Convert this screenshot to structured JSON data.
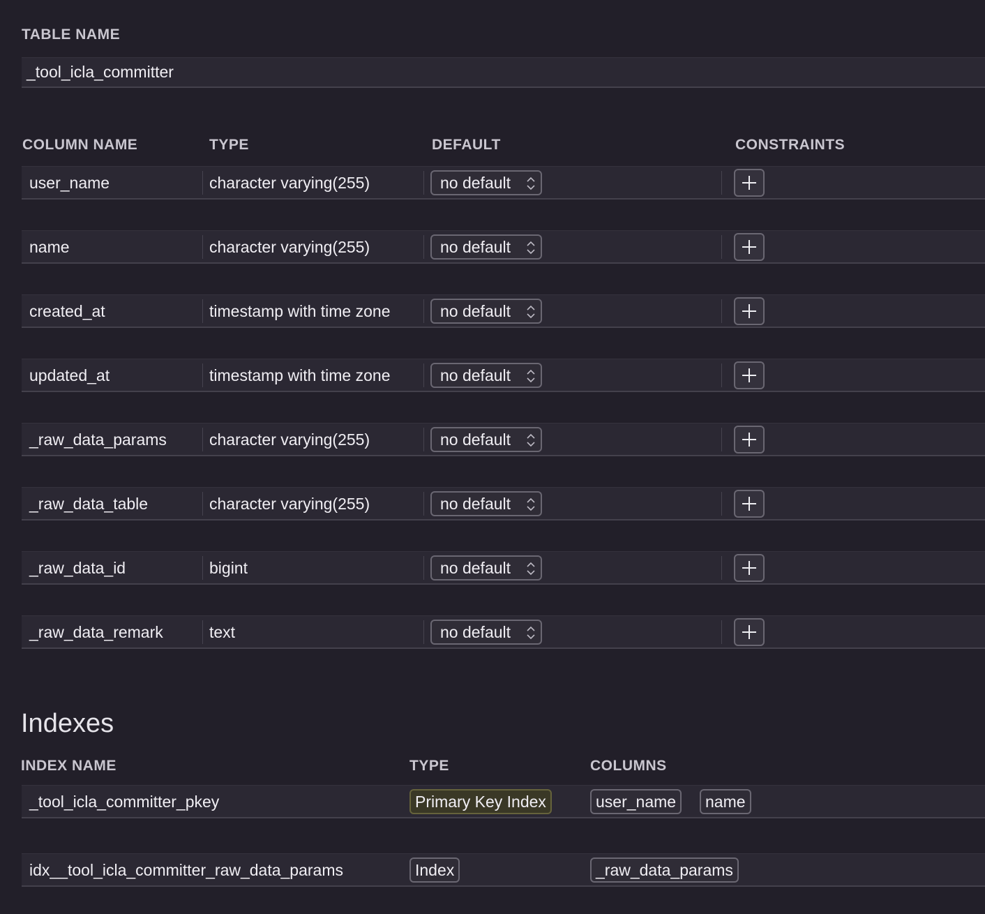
{
  "table": {
    "label": "TABLE NAME",
    "name": "_tool_icla_committer"
  },
  "columns_header": {
    "name": "COLUMN NAME",
    "type": "TYPE",
    "default": "DEFAULT",
    "constraints": "CONSTRAINTS"
  },
  "columns": [
    {
      "name": "user_name",
      "type": "character varying(255)",
      "default": "no default"
    },
    {
      "name": "name",
      "type": "character varying(255)",
      "default": "no default"
    },
    {
      "name": "created_at",
      "type": "timestamp with time zone",
      "default": "no default"
    },
    {
      "name": "updated_at",
      "type": "timestamp with time zone",
      "default": "no default"
    },
    {
      "name": "_raw_data_params",
      "type": "character varying(255)",
      "default": "no default"
    },
    {
      "name": "_raw_data_table",
      "type": "character varying(255)",
      "default": "no default"
    },
    {
      "name": "_raw_data_id",
      "type": "bigint",
      "default": "no default"
    },
    {
      "name": "_raw_data_remark",
      "type": "text",
      "default": "no default"
    }
  ],
  "indexes": {
    "title": "Indexes",
    "header": {
      "name": "INDEX NAME",
      "type": "TYPE",
      "columns": "COLUMNS"
    },
    "rows": [
      {
        "name": "_tool_icla_committer_pkey",
        "type": "Primary Key Index",
        "columns": [
          "user_name",
          "name"
        ]
      },
      {
        "name": "idx__tool_icla_committer_raw_data_params",
        "type": "Index",
        "columns": [
          "_raw_data_params"
        ]
      }
    ]
  },
  "colors": {
    "background": "#221f29",
    "row": "#2b2833",
    "primary_key_chip": "#3a3826"
  }
}
